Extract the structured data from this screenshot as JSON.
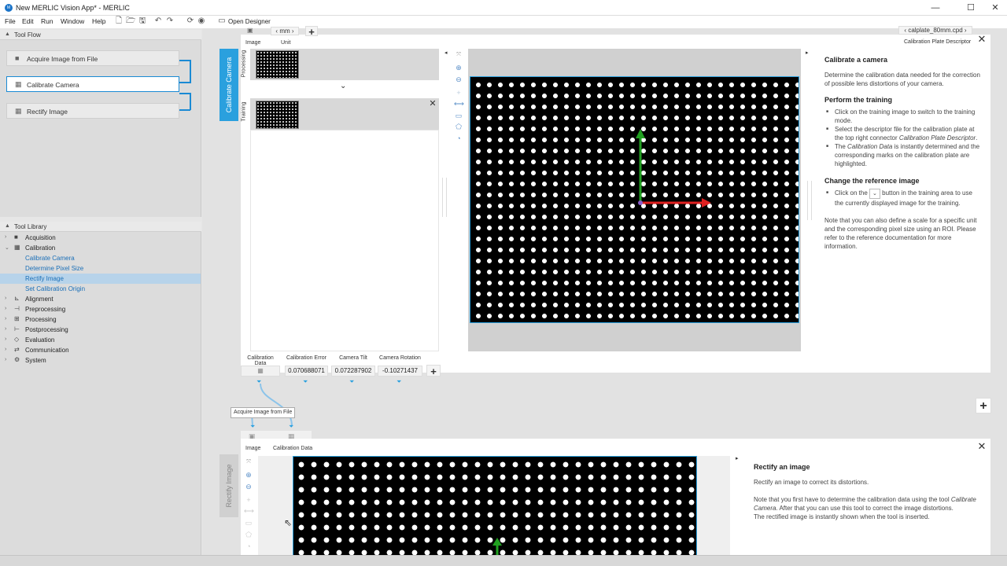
{
  "window": {
    "title": "New MERLIC Vision App* - MERLIC",
    "minimize": "—",
    "maximize": "☐",
    "close": "✕"
  },
  "menu": {
    "items": [
      "File",
      "Edit",
      "Run",
      "Window",
      "Help"
    ],
    "open_designer": "Open Designer"
  },
  "tool_flow": {
    "header": "Tool Flow",
    "items": [
      {
        "label": "Acquire Image from File",
        "icon": "camera-icon"
      },
      {
        "label": "Calibrate Camera",
        "icon": "calibration-grid-icon"
      },
      {
        "label": "Rectify Image",
        "icon": "calibration-grid-icon"
      }
    ]
  },
  "tool_library": {
    "header": "Tool Library",
    "items": [
      {
        "label": "Acquisition",
        "level": 0,
        "expanded": false
      },
      {
        "label": "Calibration",
        "level": 0,
        "expanded": true
      },
      {
        "label": "Calibrate Camera",
        "level": 1
      },
      {
        "label": "Determine Pixel Size",
        "level": 1
      },
      {
        "label": "Rectify Image",
        "level": 1,
        "selected": true
      },
      {
        "label": "Set Calibration Origin",
        "level": 1
      },
      {
        "label": "Alignment",
        "level": 0,
        "expanded": false
      },
      {
        "label": "Preprocessing",
        "level": 0,
        "expanded": false
      },
      {
        "label": "Processing",
        "level": 0,
        "expanded": false
      },
      {
        "label": "Postprocessing",
        "level": 0,
        "expanded": false
      },
      {
        "label": "Evaluation",
        "level": 0,
        "expanded": false
      },
      {
        "label": "Communication",
        "level": 0,
        "expanded": false
      },
      {
        "label": "System",
        "level": 0,
        "expanded": false
      }
    ]
  },
  "calibrate_tool": {
    "tab_label": "Calibrate Camera",
    "inputs": {
      "image_label": "Image",
      "unit_label": "Unit",
      "unit_value": "mm",
      "add": "+"
    },
    "processing_label": "Processing",
    "training_label": "Training",
    "descriptor_file": "calplate_80mm.cpd",
    "descriptor_label": "Calibration Plate Descriptor",
    "results": [
      {
        "label": "Calibration Data",
        "value": ""
      },
      {
        "label": "Calibration Error",
        "value": "0.070688071"
      },
      {
        "label": "Camera Tilt",
        "value": "0.072287902"
      },
      {
        "label": "Camera Rotation",
        "value": "-0.10271437"
      }
    ],
    "help": {
      "title": "Calibrate a camera",
      "intro": "Determine the calibration data needed for the correction of possible lens distortions of your camera.",
      "training_title": "Perform the training",
      "training_b1": "Click on the training image to switch to the training mode.",
      "training_b2a": "Select the descriptor file for the calibration plate at the top right connector ",
      "training_b2b": "Calibration Plate Descriptor",
      "training_b2c": ".",
      "training_b3a": "The ",
      "training_b3b": "Calibration Data",
      "training_b3c": " is instantly determined and the corresponding marks on the calibration plate are highlighted.",
      "ref_title": "Change the reference image",
      "ref_b1a": "Click on the",
      "ref_b1b": "button in the training area to use the currently displayed image for the training.",
      "note": "Note that you can also define a scale for a specific unit and the corresponding pixel size using an ROI. Please refer to the reference documentation for more information."
    }
  },
  "connection_tooltip": "Acquire Image from File",
  "rectify_tool": {
    "tab_label": "Rectify Image",
    "inputs": {
      "image_label": "Image",
      "calib_label": "Calibration Data"
    },
    "help": {
      "title": "Rectify an image",
      "intro": "Rectify an image to correct its distortions.",
      "note_a": "Note that you first have to determine the calibration data using the tool ",
      "note_b": "Calibrate Camera",
      "note_c": ". After that you can use this tool to correct the image distortions.",
      "note2": "The rectified image is instantly shown when the tool is inserted."
    }
  },
  "colors": {
    "accent": "#2aa0de",
    "selected": "#b7d3ea",
    "axis_x": "#e02020",
    "axis_y": "#20a020"
  }
}
